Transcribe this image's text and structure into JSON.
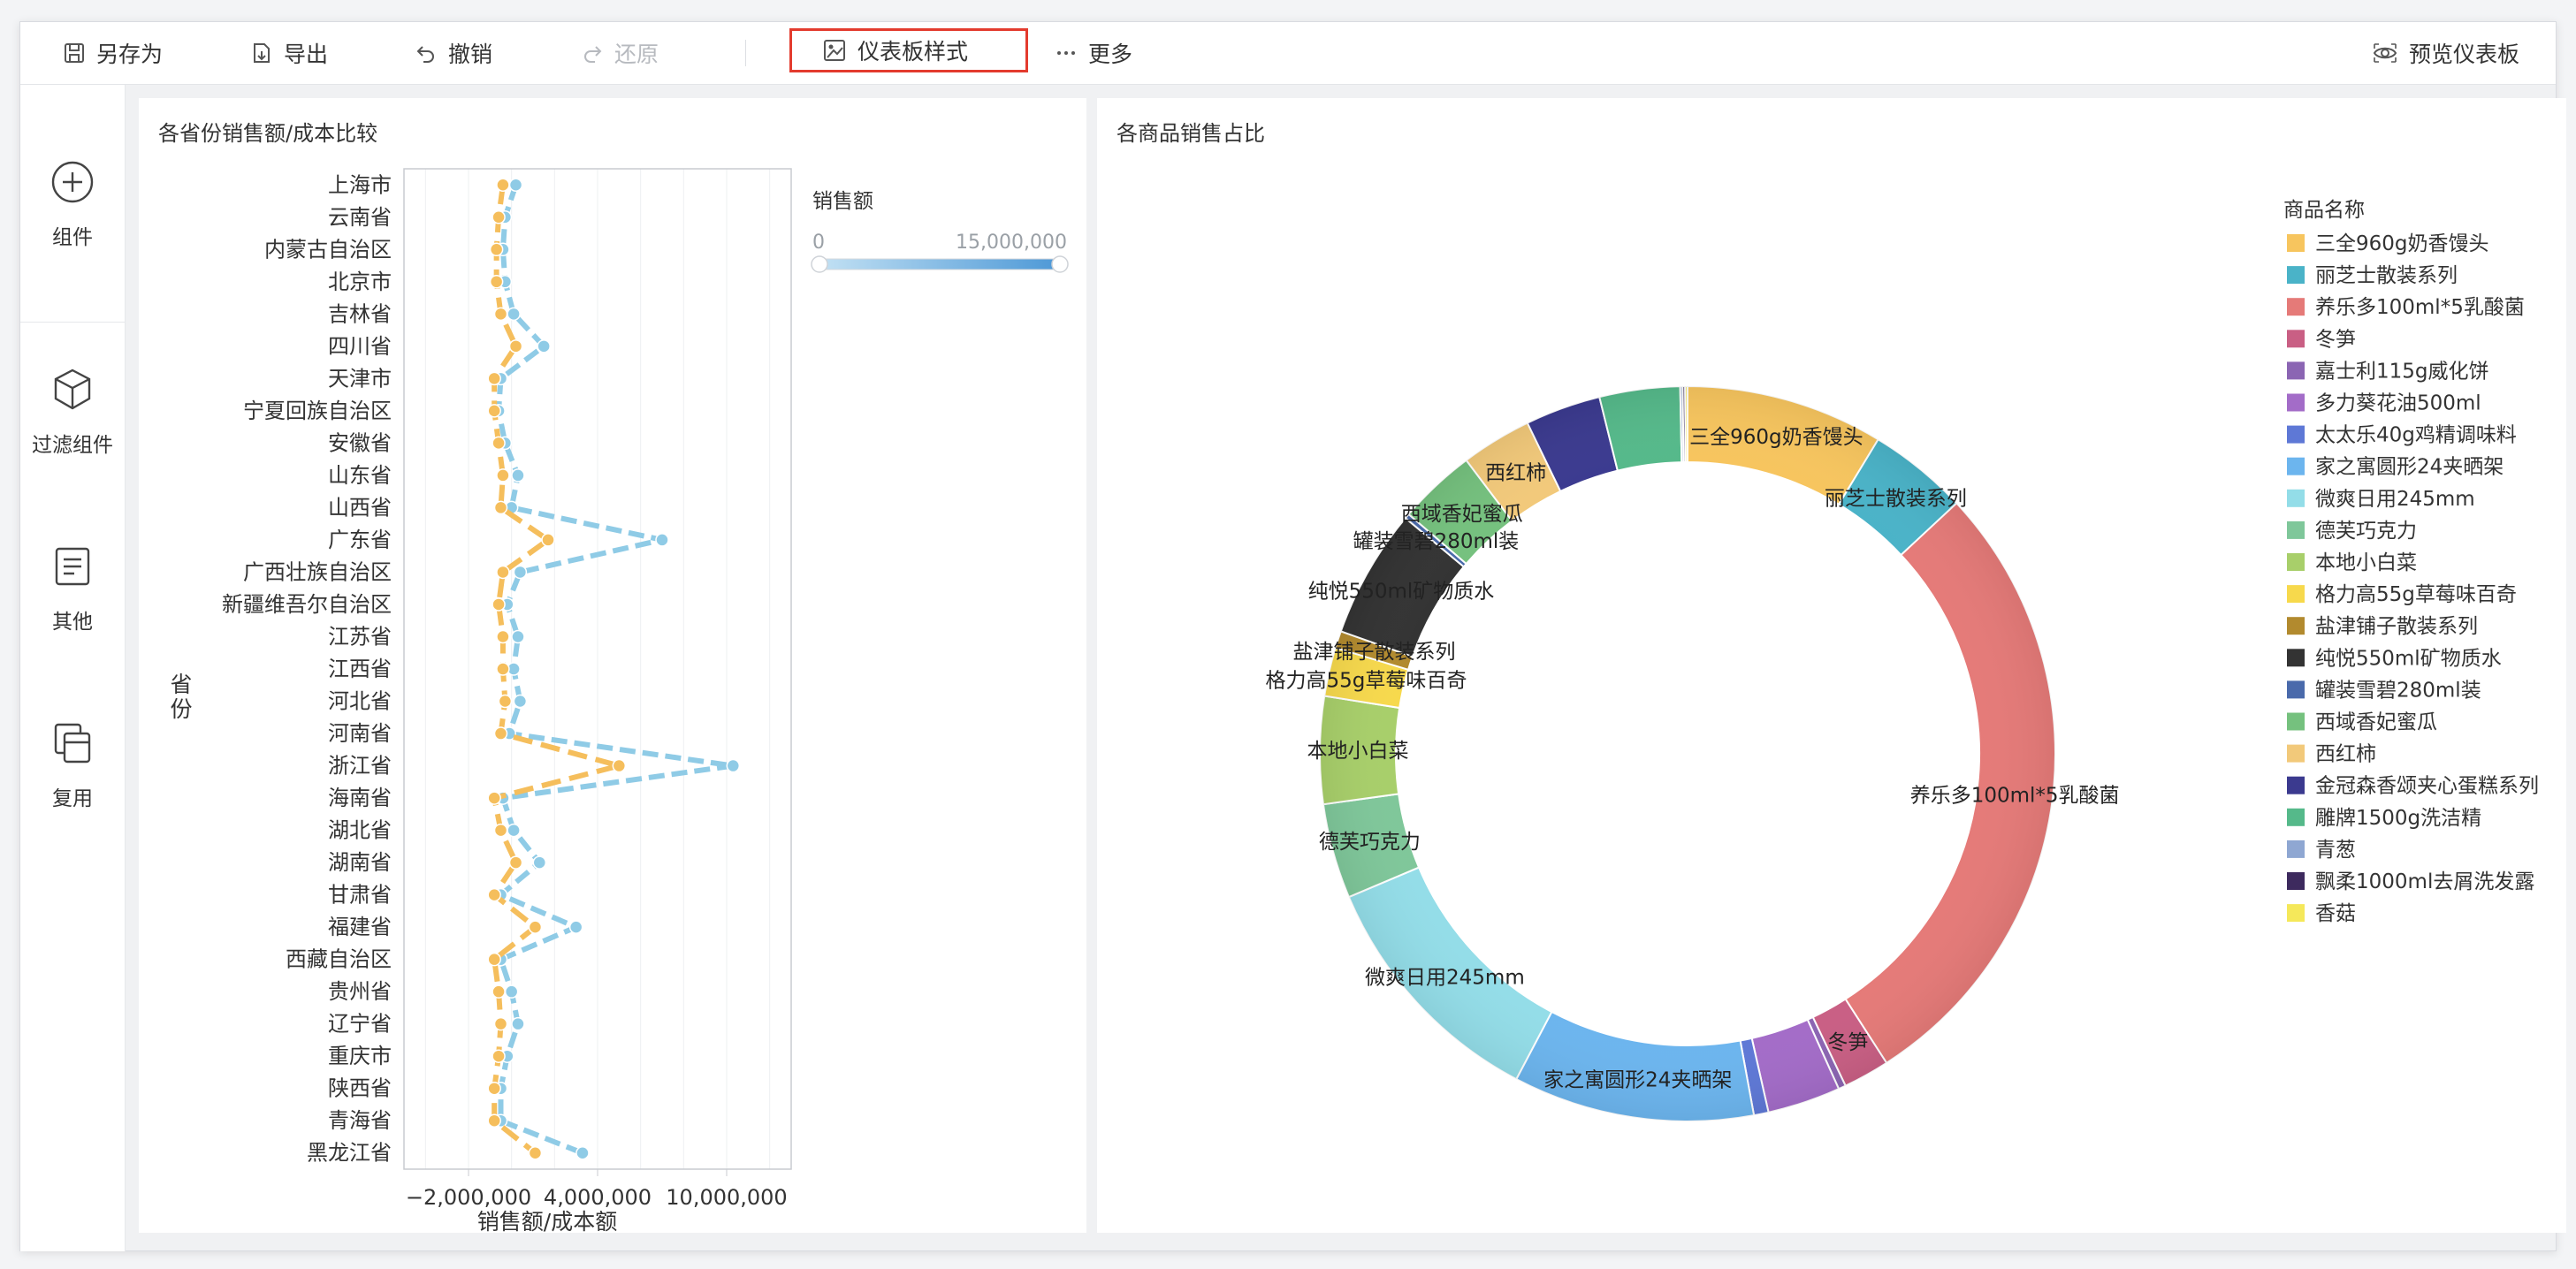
{
  "toolbar": {
    "save_as": "另存为",
    "export": "导出",
    "undo": "撤销",
    "redo": "还原",
    "dashboard_style": "仪表板样式",
    "more": "更多",
    "preview": "预览仪表板"
  },
  "sidebar": {
    "items": [
      {
        "label": "组件",
        "icon": "plus-circle-icon"
      },
      {
        "label": "过滤组件",
        "icon": "cube-icon"
      },
      {
        "label": "其他",
        "icon": "document-icon"
      },
      {
        "label": "复用",
        "icon": "copy-icon"
      }
    ]
  },
  "left_chart": {
    "title": "各省份销售额/成本比较",
    "legend_title": "销售额",
    "legend_min": "0",
    "legend_max": "15,000,000"
  },
  "right_chart": {
    "title": "各商品销售占比",
    "legend_title": "商品名称"
  },
  "chart_data": [
    {
      "type": "line",
      "orientation": "horizontal",
      "title": "各省份销售额/成本比较",
      "xlabel": "销售额/成本额",
      "ylabel": "省份",
      "xlim": [
        -5000000,
        13000000
      ],
      "xticks": [
        "−2,000,000",
        "4,000,000",
        "10,000,000"
      ],
      "xtick_values": [
        -2000000,
        4000000,
        10000000
      ],
      "grid": true,
      "categories": [
        "上海市",
        "云南省",
        "内蒙古自治区",
        "北京市",
        "吉林省",
        "四川省",
        "天津市",
        "宁夏回族自治区",
        "安徽省",
        "山东省",
        "山西省",
        "广东省",
        "广西壮族自治区",
        "新疆维吾尔自治区",
        "江苏省",
        "江西省",
        "河北省",
        "河南省",
        "浙江省",
        "海南省",
        "湖北省",
        "湖南省",
        "甘肃省",
        "福建省",
        "西藏自治区",
        "贵州省",
        "辽宁省",
        "重庆市",
        "陕西省",
        "青海省",
        "黑龙江省"
      ],
      "series": [
        {
          "color": "#8fcbe6",
          "values": [
            200000,
            -300000,
            -400000,
            -300000,
            100000,
            1500000,
            -500000,
            -600000,
            -300000,
            300000,
            0,
            7000000,
            400000,
            -200000,
            300000,
            100000,
            400000,
            -100000,
            10300000,
            -400000,
            100000,
            1300000,
            -500000,
            3000000,
            -500000,
            0,
            300000,
            -200000,
            -500000,
            -500000,
            3300000
          ]
        },
        {
          "color": "#f5be5c",
          "values": [
            -400000,
            -600000,
            -700000,
            -700000,
            -500000,
            200000,
            -800000,
            -800000,
            -600000,
            -400000,
            -500000,
            1700000,
            -400000,
            -600000,
            -400000,
            -400000,
            -300000,
            -500000,
            5000000,
            -800000,
            -500000,
            200000,
            -800000,
            1100000,
            -800000,
            -600000,
            -500000,
            -600000,
            -800000,
            -800000,
            1100000
          ]
        }
      ],
      "legend": {
        "title": "销售额",
        "type": "gradient",
        "min": "0",
        "max": "15,000,000",
        "placement": "top-right"
      }
    },
    {
      "type": "pie",
      "style": "donut",
      "title": "各商品销售占比",
      "legend_title": "商品名称",
      "legend_placement": "right",
      "slices": [
        {
          "label": "三全960g奶香馒头",
          "value": 8.1,
          "color": "#f7c55e",
          "shown": true
        },
        {
          "label": "丽芝士散装系列",
          "value": 4.1,
          "color": "#4ab3c8",
          "shown": true
        },
        {
          "label": "养乐多100ml*5乳酸菌",
          "value": 26.0,
          "color": "#e57a78",
          "shown": true
        },
        {
          "label": "冬笋",
          "value": 1.9,
          "color": "#c95f84",
          "shown": true
        },
        {
          "label": "嘉士利115g威化饼",
          "value": 0.3,
          "color": "#8b65b3",
          "shown": false
        },
        {
          "label": "多力葵花油500ml",
          "value": 3.0,
          "color": "#a36cc8",
          "shown": false
        },
        {
          "label": "太太乐40g鸡精调味料",
          "value": 0.6,
          "color": "#5e78d6",
          "shown": false
        },
        {
          "label": "家之寓圆形24夹晒架",
          "value": 9.9,
          "color": "#6cb5ee",
          "shown": true
        },
        {
          "label": "微爽日用245mm",
          "value": 10.2,
          "color": "#93dde8",
          "shown": true
        },
        {
          "label": "德芙巧克力",
          "value": 3.9,
          "color": "#7fc79a",
          "shown": true
        },
        {
          "label": "本地小白菜",
          "value": 4.4,
          "color": "#a8cf6a",
          "shown": true
        },
        {
          "label": "格力高55g草莓味百奇",
          "value": 2.0,
          "color": "#f7d94c",
          "shown": true
        },
        {
          "label": "盐津铺子散装系列",
          "value": 0.7,
          "color": "#b28a2e",
          "shown": true
        },
        {
          "label": "纯悦550ml矿物质水",
          "value": 5.3,
          "color": "#333333",
          "shown": true
        },
        {
          "label": "罐装雪碧280ml装",
          "value": 0.2,
          "color": "#4a6aab",
          "shown": true
        },
        {
          "label": "西域香妃蜜瓜",
          "value": 3.2,
          "color": "#75c17e",
          "shown": true
        },
        {
          "label": "西红柿",
          "value": 2.9,
          "color": "#f2c97a",
          "shown": true
        },
        {
          "label": "金冠森香颂夹心蛋糕系列",
          "value": 3.1,
          "color": "#3b3a8f",
          "shown": false
        },
        {
          "label": "雕牌1500g洗洁精",
          "value": 3.3,
          "color": "#55b98a",
          "shown": false
        },
        {
          "label": "青葱",
          "value": 0.1,
          "color": "#8fa7d2",
          "shown": false
        },
        {
          "label": "飘柔1000ml去屑洗发露",
          "value": 0.1,
          "color": "#3d2a5e",
          "shown": false
        },
        {
          "label": "香菇",
          "value": 0.1,
          "color": "#f5e85a",
          "shown": false
        }
      ]
    }
  ]
}
